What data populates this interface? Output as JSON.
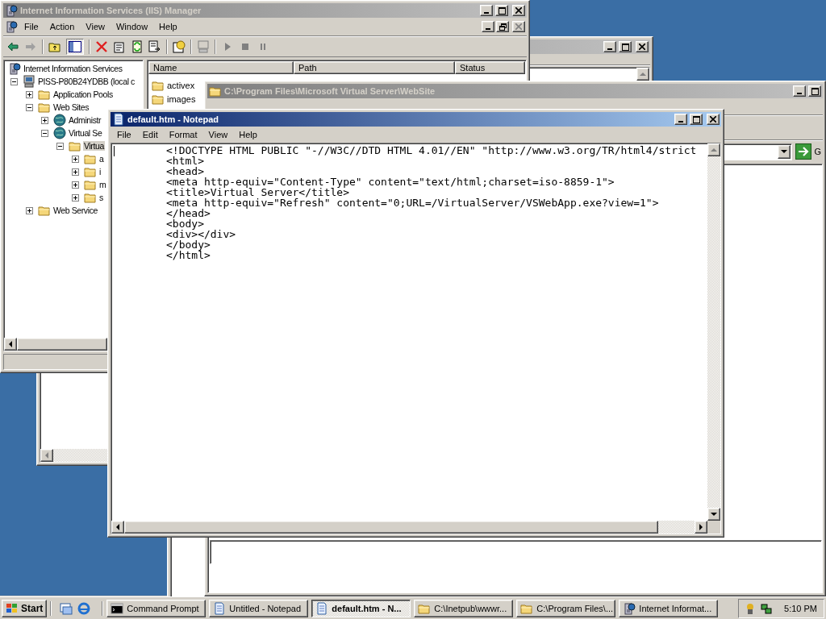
{
  "explorer_back": {
    "active": false
  },
  "explorer_front": {
    "title": "C:\\Program Files\\Microsoft Virtual Server\\WebSite",
    "active": false,
    "go_label": "G"
  },
  "iis": {
    "title": "Internet Information Services (IIS) Manager",
    "active": false,
    "menu": [
      "File",
      "Action",
      "View",
      "Window",
      "Help"
    ],
    "document_close_disabled": true,
    "console_tree_shown": true,
    "tree": [
      {
        "label": "Internet Information Services",
        "kind": "service",
        "selected": false,
        "children": [
          {
            "label": "PISS-P80B24YDBB (local c",
            "kind": "computer",
            "expanded": true,
            "selected": false,
            "children": [
              {
                "label": "Application Pools",
                "kind": "folder",
                "expanded": false,
                "selected": false
              },
              {
                "label": "Web Sites",
                "kind": "folder",
                "expanded": true,
                "selected": false,
                "children": [
                  {
                    "label": "Administr",
                    "kind": "site",
                    "expanded": false,
                    "selected": false
                  },
                  {
                    "label": "Virtual Se",
                    "kind": "site",
                    "expanded": true,
                    "selected": false,
                    "children": [
                      {
                        "label": "Virtua",
                        "kind": "folder",
                        "expanded": true,
                        "selected": true,
                        "children": [
                          {
                            "label": "a",
                            "kind": "folder",
                            "expanded": false,
                            "selected": false
                          },
                          {
                            "label": "i",
                            "kind": "folder",
                            "expanded": false,
                            "selected": false
                          },
                          {
                            "label": "m",
                            "kind": "folder",
                            "expanded": false,
                            "selected": false
                          },
                          {
                            "label": "s",
                            "kind": "folder",
                            "expanded": false,
                            "selected": false
                          }
                        ]
                      }
                    ]
                  }
                ]
              },
              {
                "label": "Web Service",
                "kind": "folder",
                "expanded": false,
                "selected": false
              }
            ]
          }
        ]
      }
    ],
    "list": {
      "columns": [
        "Name",
        "Path",
        "Status"
      ],
      "rows": [
        {
          "name": "activex"
        },
        {
          "name": "images"
        }
      ]
    }
  },
  "notepad": {
    "title": "default.htm - Notepad",
    "active": true,
    "menu": [
      "File",
      "Edit",
      "Format",
      "View",
      "Help"
    ],
    "lines": [
      "<!DOCTYPE HTML PUBLIC \"-//W3C//DTD HTML 4.01//EN\" \"http://www.w3.org/TR/html4/strict",
      "<html>",
      "<head>",
      "<meta http-equiv=\"Content-Type\" content=\"text/html;charset=iso-8859-1\">",
      "<title>Virtual Server</title>",
      "<meta http-equiv=\"Refresh\" content=\"0;URL=/VirtualServer/VSWebApp.exe?view=1\">",
      "</head>",
      "<body>",
      "<div></div>",
      "</body>",
      "</html>"
    ]
  },
  "taskbar": {
    "start": "Start",
    "tasks": [
      {
        "label": "Command Prompt",
        "kind": "console",
        "selected": false
      },
      {
        "label": "Untitled - Notepad",
        "kind": "notepad",
        "selected": false
      },
      {
        "label": "default.htm - N...",
        "kind": "notepad",
        "selected": true
      },
      {
        "label": "C:\\Inetpub\\wwwr...",
        "kind": "folder",
        "selected": false
      },
      {
        "label": "C:\\Program Files\\...",
        "kind": "folder",
        "selected": false
      },
      {
        "label": "Internet Informat...",
        "kind": "service",
        "selected": false
      }
    ],
    "clock": "5:10 PM"
  }
}
